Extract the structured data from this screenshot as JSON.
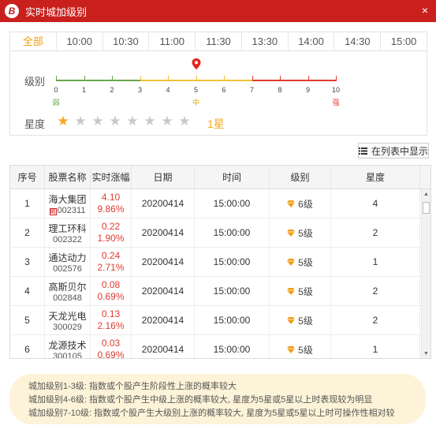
{
  "window": {
    "title": "实时城加级别",
    "logo_glyph": "B",
    "close_glyph": "×"
  },
  "tabs": [
    "全部",
    "10:00",
    "10:30",
    "11:00",
    "11:30",
    "13:30",
    "14:00",
    "14:30",
    "15:00"
  ],
  "level": {
    "label": "级别",
    "scale": [
      "0",
      "1",
      "2",
      "3",
      "4",
      "5",
      "6",
      "7",
      "8",
      "9",
      "10"
    ],
    "weak": "弱",
    "mid": "中",
    "strong": "强",
    "selected": 5,
    "colors": {
      "low": "#6aa84f",
      "mid": "#f1c232",
      "high": "#e03c31"
    }
  },
  "star_rating": {
    "label": "星度",
    "value": 1,
    "max": 8,
    "value_text": "1星"
  },
  "list_button": {
    "label": "在列表中显示",
    "icon": "list-icon"
  },
  "table": {
    "headers": [
      "序号",
      "股票名称",
      "实时涨幅",
      "日期",
      "时间",
      "级别",
      "星度"
    ],
    "rows": [
      {
        "no": "1",
        "name": "海大集团",
        "code": "002311",
        "mark": "融",
        "change": "4.10",
        "pct": "9.86%",
        "date": "20200414",
        "time": "15:00:00",
        "level": "6级",
        "stars": "4"
      },
      {
        "no": "2",
        "name": "理工环科",
        "code": "002322",
        "mark": "",
        "change": "0.22",
        "pct": "1.90%",
        "date": "20200414",
        "time": "15:00:00",
        "level": "5级",
        "stars": "2"
      },
      {
        "no": "3",
        "name": "通达动力",
        "code": "002576",
        "mark": "",
        "change": "0.24",
        "pct": "2.71%",
        "date": "20200414",
        "time": "15:00:00",
        "level": "5级",
        "stars": "1"
      },
      {
        "no": "4",
        "name": "高斯贝尔",
        "code": "002848",
        "mark": "",
        "change": "0.08",
        "pct": "0.69%",
        "date": "20200414",
        "time": "15:00:00",
        "level": "5级",
        "stars": "2"
      },
      {
        "no": "5",
        "name": "天龙光电",
        "code": "300029",
        "mark": "",
        "change": "0.13",
        "pct": "2.16%",
        "date": "20200414",
        "time": "15:00:00",
        "level": "5级",
        "stars": "2"
      },
      {
        "no": "6",
        "name": "龙源技术",
        "code": "300105",
        "mark": "",
        "change": "0.03",
        "pct": "0.69%",
        "date": "20200414",
        "time": "15:00:00",
        "level": "5级",
        "stars": "1"
      }
    ]
  },
  "notes": [
    "城加级别1-3级: 指数或个股产生阶段性上涨的概率较大",
    "城加级别4-6级: 指数或个股产生中级上涨的概率较大, 星度为5星或5星以上时表现较为明显",
    "城加级别7-10级: 指数或个股产生大级别上涨的概率较大, 星度为5星或5星以上时可操作性相对较"
  ]
}
